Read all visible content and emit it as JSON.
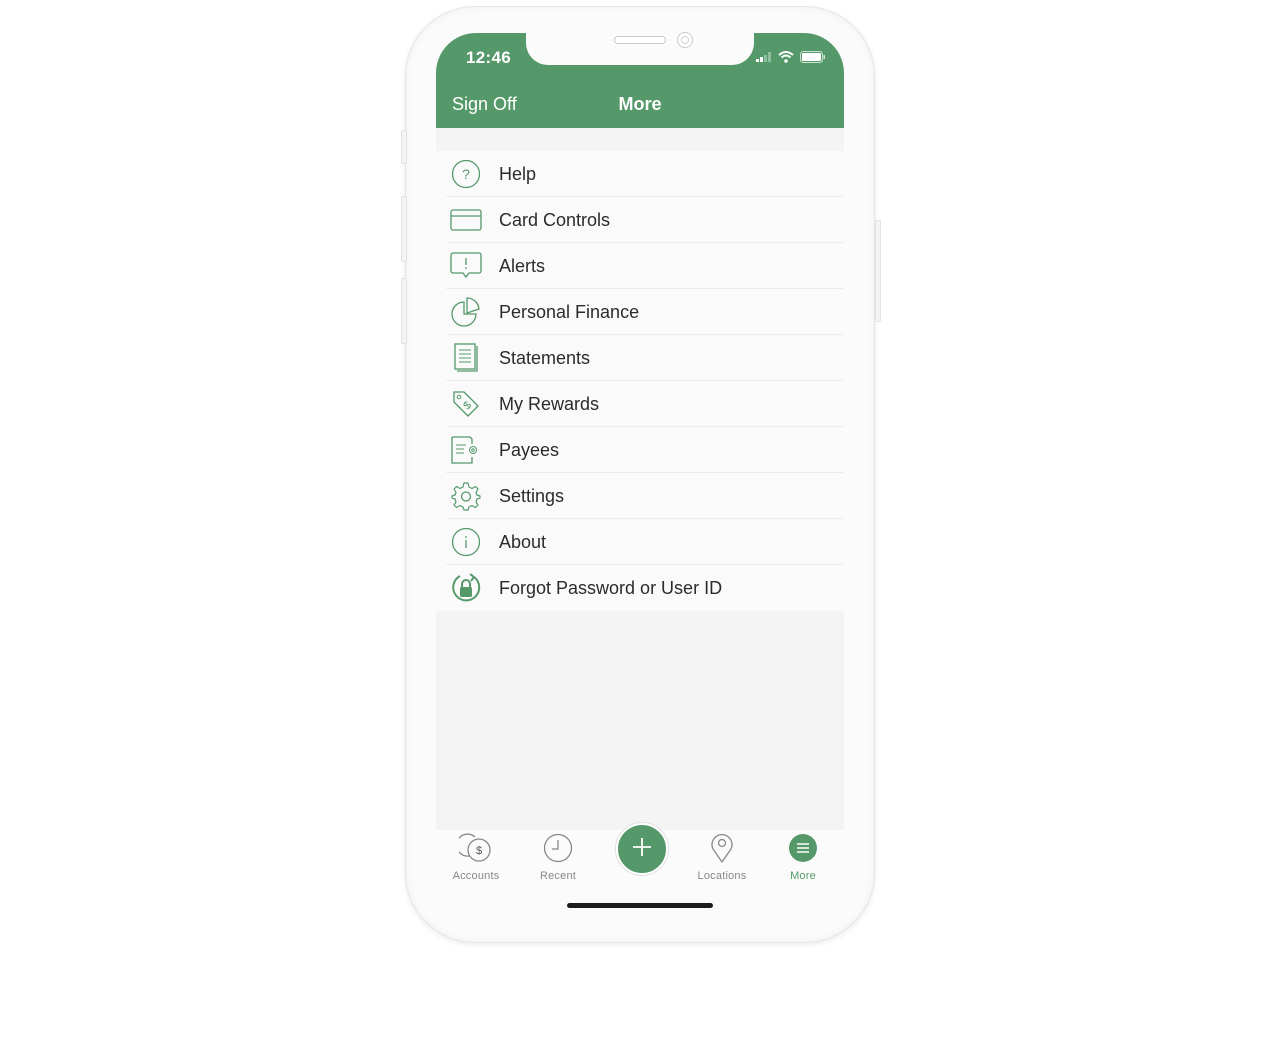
{
  "status_bar": {
    "time": "12:46"
  },
  "header": {
    "left_button": "Sign Off",
    "title": "More"
  },
  "menu": [
    {
      "label": "Help",
      "icon": "help-icon"
    },
    {
      "label": "Card Controls",
      "icon": "card-icon"
    },
    {
      "label": "Alerts",
      "icon": "alert-icon"
    },
    {
      "label": "Personal Finance",
      "icon": "pie-chart-icon"
    },
    {
      "label": "Statements",
      "icon": "document-icon"
    },
    {
      "label": "My Rewards",
      "icon": "price-tag-icon"
    },
    {
      "label": "Payees",
      "icon": "payees-icon"
    },
    {
      "label": "Settings",
      "icon": "gear-icon"
    },
    {
      "label": "About",
      "icon": "info-icon"
    },
    {
      "label": "Forgot Password or User ID",
      "icon": "lock-refresh-icon"
    }
  ],
  "tabbar": {
    "tabs": [
      {
        "label": "Accounts",
        "icon": "coins-icon",
        "active": false
      },
      {
        "label": "Recent",
        "icon": "clock-icon",
        "active": false
      },
      {
        "label": "Locations",
        "icon": "map-pin-icon",
        "active": false
      },
      {
        "label": "More",
        "icon": "menu-icon",
        "active": true
      }
    ],
    "fab_icon": "plus-icon"
  },
  "colors": {
    "brand": "#55996b",
    "text": "#2b2b2b",
    "tab_inactive": "#888888"
  }
}
